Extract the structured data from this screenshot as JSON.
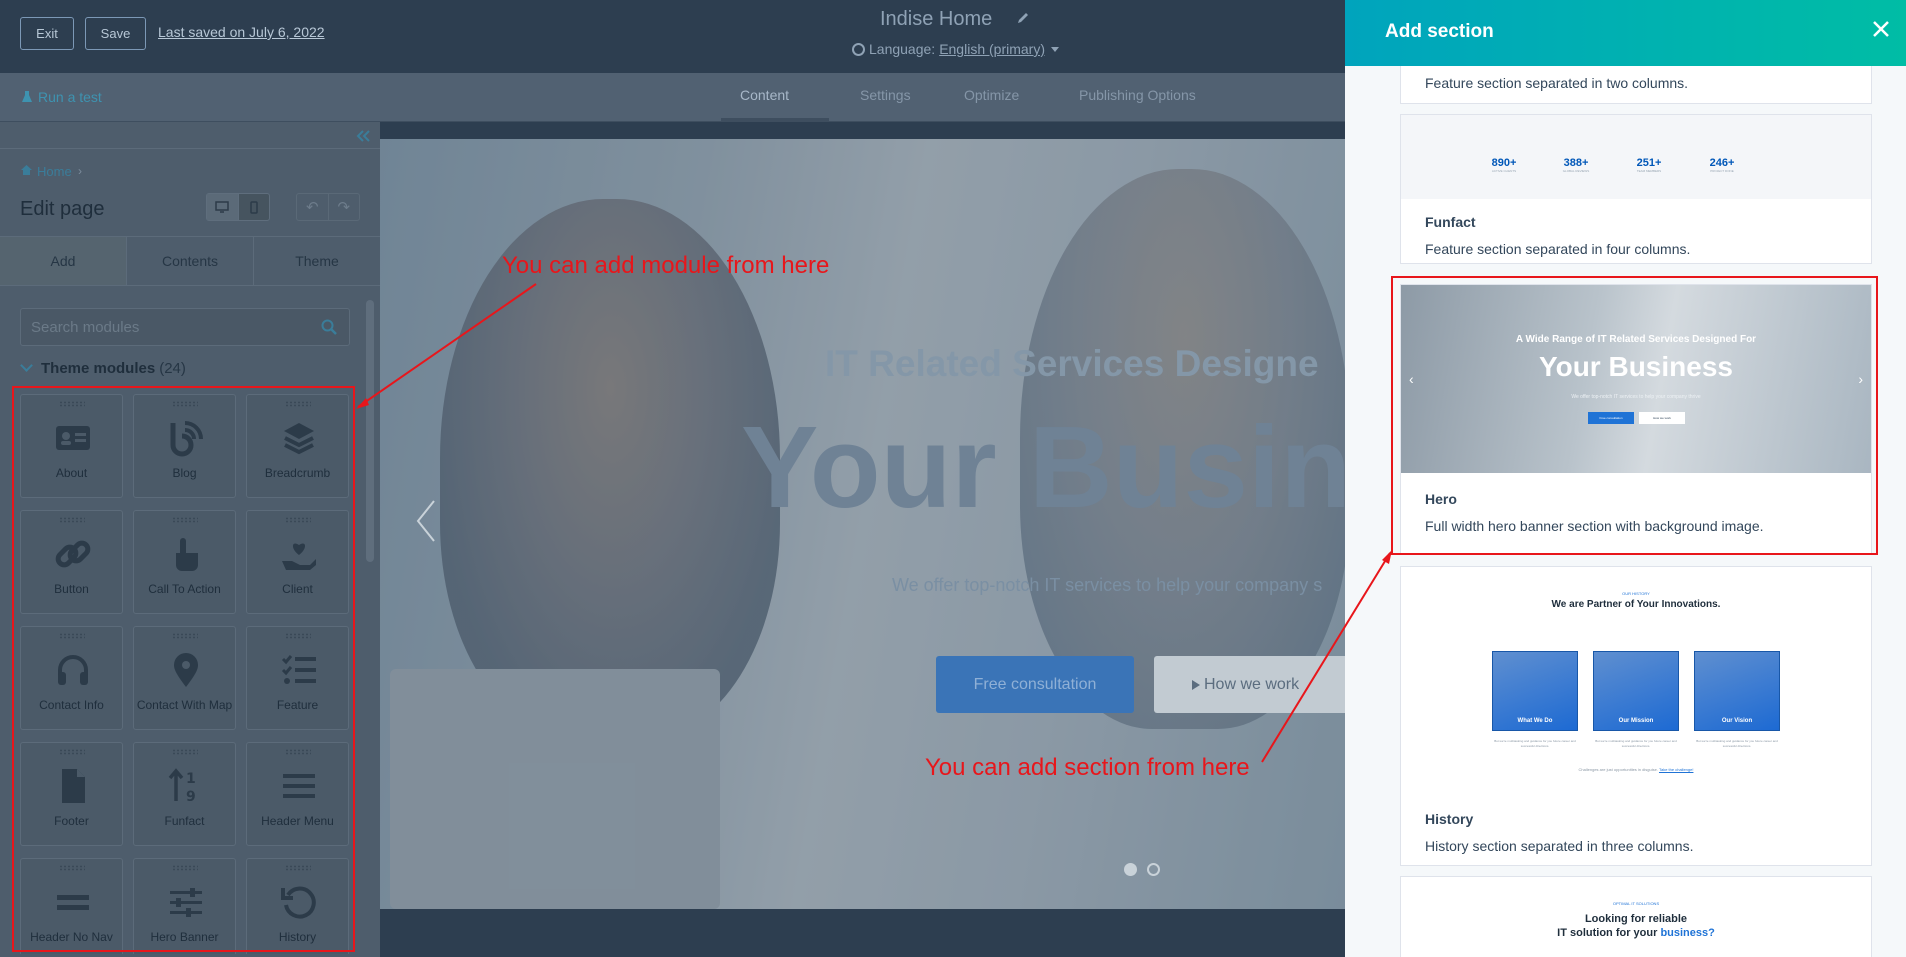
{
  "header": {
    "exit_label": "Exit",
    "save_label": "Save",
    "last_saved": "Last saved on July 6, 2022",
    "page_name": "Indise Home",
    "language_label": "Language:",
    "language_value": "English (primary)"
  },
  "subbar": {
    "run_test": "Run a test",
    "tabs": [
      {
        "label": "Content",
        "active": true
      },
      {
        "label": "Settings",
        "active": false
      },
      {
        "label": "Optimize",
        "active": false
      },
      {
        "label": "Publishing Options",
        "active": false
      }
    ]
  },
  "left_panel": {
    "breadcrumb_home": "Home",
    "title": "Edit page",
    "tabs": [
      "Add",
      "Contents",
      "Theme"
    ],
    "search_placeholder": "Search modules",
    "theme_modules_label": "Theme modules",
    "theme_modules_count": "(24)",
    "modules": [
      {
        "label": "About",
        "icon": "id-card-icon"
      },
      {
        "label": "Blog",
        "icon": "blog-icon"
      },
      {
        "label": "Breadcrumb",
        "icon": "layers-icon"
      },
      {
        "label": "Button",
        "icon": "link-icon"
      },
      {
        "label": "Call To Action",
        "icon": "pointer-hand-icon"
      },
      {
        "label": "Client",
        "icon": "heart-hand-icon"
      },
      {
        "label": "Contact Info",
        "icon": "headphones-icon"
      },
      {
        "label": "Contact With Map",
        "icon": "map-pin-icon"
      },
      {
        "label": "Feature",
        "icon": "checklist-icon"
      },
      {
        "label": "Footer",
        "icon": "document-icon"
      },
      {
        "label": "Funfact",
        "icon": "sort-numeric-icon"
      },
      {
        "label": "Header Menu",
        "icon": "hamburger-icon"
      },
      {
        "label": "Header No Nav",
        "icon": "equals-icon"
      },
      {
        "label": "Hero Banner",
        "icon": "sliders-icon"
      },
      {
        "label": "History",
        "icon": "undo-icon"
      }
    ]
  },
  "canvas": {
    "hero_sub": "IT Related Services Designe",
    "hero_title": "Your Busin",
    "hero_desc": "We offer top-notch IT services to help your company s",
    "btn_primary": "Free consultation",
    "btn_secondary": "How we work"
  },
  "right_panel": {
    "title": "Add section",
    "sections": [
      {
        "name": "",
        "desc": "Feature section separated in two columns."
      },
      {
        "name": "Funfact",
        "desc": "Feature section separated in four columns.",
        "stats": [
          {
            "value": "890+",
            "label": "ACTIVE CLIENTS"
          },
          {
            "value": "388+",
            "label": "GLOBAL REVIEWS"
          },
          {
            "value": "251+",
            "label": "TEAM MEMBERS"
          },
          {
            "value": "246+",
            "label": "PROJECT DONE"
          }
        ]
      },
      {
        "name": "Hero",
        "desc": "Full width hero banner section with background image.",
        "thumb_sub": "A Wide Range of IT Related Services Designed For",
        "thumb_title": "Your Business",
        "thumb_desc": "We offer top-notch IT services to help your company thrive",
        "thumb_btn1": "Free consultation",
        "thumb_btn2": "How we work"
      },
      {
        "name": "History",
        "desc": "History section separated in three columns.",
        "thumb_eyebrow": "OUR HISTORY",
        "thumb_title": "We are Partner of Your Innovations.",
        "cards": [
          "What We Do",
          "Our Mission",
          "Our Vision"
        ],
        "card_text": "But we're multitasking and guidance for you future career and successful directions.",
        "thumb_footer": "Challenges are just opportunities in disguise.",
        "thumb_footer_link": "Take the challenge!"
      },
      {
        "thumb_eyebrow": "OPTIMAL IT SOLUTIONS",
        "thumb_line1": "Looking for reliable",
        "thumb_line2_a": "IT solution for your",
        "thumb_line2_b": "business?"
      }
    ]
  },
  "annotations": {
    "module": "You can add module from here",
    "section": "You can add section from here"
  },
  "colors": {
    "header_bg": "#2d3e50",
    "accent_teal": "#00a4bd",
    "annotation_red": "#e8161b",
    "primary_blue": "#1f73d6"
  }
}
